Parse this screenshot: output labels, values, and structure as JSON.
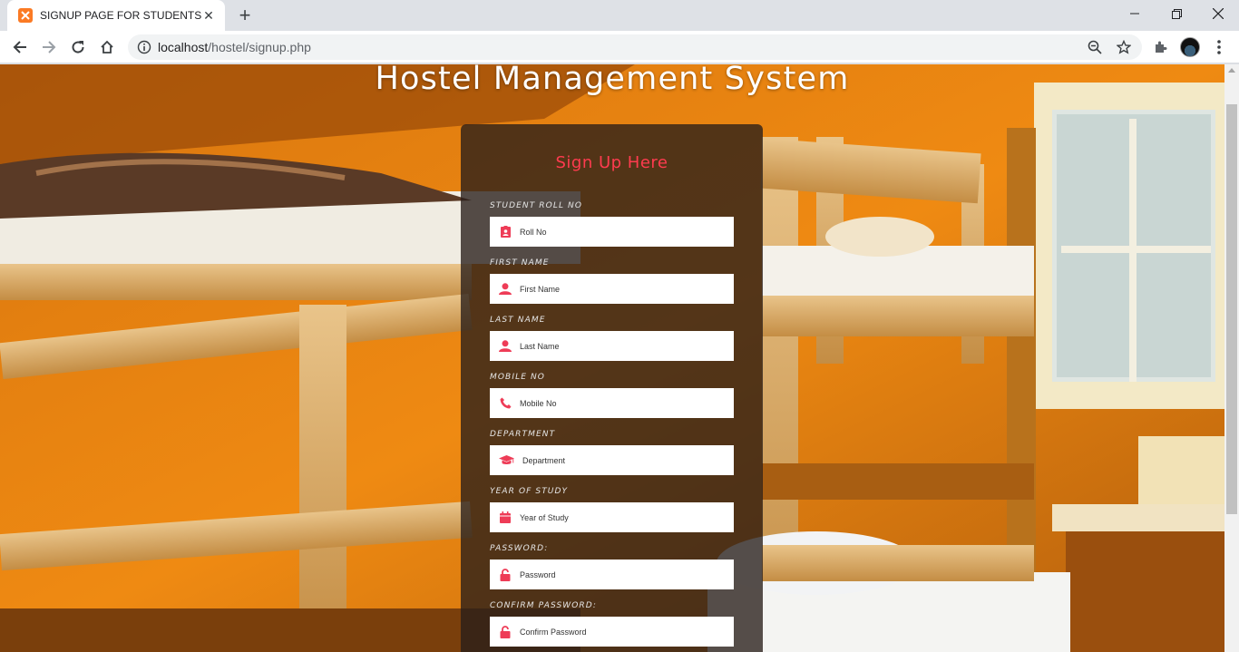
{
  "browser": {
    "tab_title": "SIGNUP PAGE FOR STUDENTS",
    "url_host": "localhost",
    "url_path": "/hostel/signup.php",
    "accent": "#fb7a24"
  },
  "page": {
    "title": "Hostel Management System",
    "form_heading": "Sign Up Here",
    "heading_color": "#ff3b4f"
  },
  "fields": [
    {
      "label": "STUDENT ROLL NO",
      "placeholder": "Roll No",
      "icon": "id-badge-icon"
    },
    {
      "label": "FIRST NAME",
      "placeholder": "First Name",
      "icon": "user-icon"
    },
    {
      "label": "LAST NAME",
      "placeholder": "Last Name",
      "icon": "user-icon"
    },
    {
      "label": "MOBILE NO",
      "placeholder": "Mobile No",
      "icon": "phone-icon"
    },
    {
      "label": "DEPARTMENT",
      "placeholder": "Department",
      "icon": "graduation-cap-icon"
    },
    {
      "label": "YEAR OF STUDY",
      "placeholder": "Year of Study",
      "icon": "calendar-icon"
    },
    {
      "label": "PASSWORD:",
      "placeholder": "Password",
      "icon": "lock-icon"
    },
    {
      "label": "CONFIRM PASSWORD:",
      "placeholder": "Confirm Password",
      "icon": "lock-icon"
    }
  ]
}
